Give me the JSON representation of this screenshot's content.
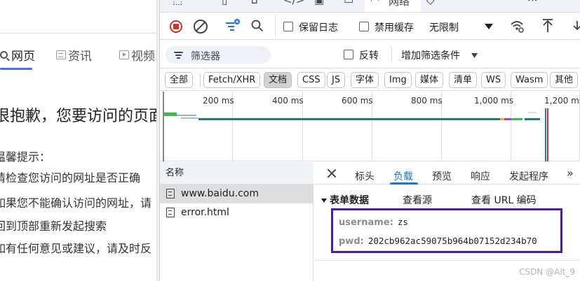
{
  "baidu": {
    "nav": [
      {
        "label": "网页",
        "icon": "search-icon",
        "active": true
      },
      {
        "label": "资讯",
        "icon": "news-icon",
        "active": false
      },
      {
        "label": "视频",
        "icon": "video-icon",
        "active": false
      }
    ],
    "headline": "很抱歉，您要访问的页面",
    "lines": [
      "温馨提示：",
      "请检查您访问的网址是否正确",
      "如果您不能确认访问的网址，请",
      "回到顶部重新发起搜索",
      "如有任何意见或建议，请及时反"
    ]
  },
  "devtools": {
    "top_tabs": [
      "网络"
    ],
    "toolbar": {
      "preserve_log": "保留日志",
      "disable_cache": "禁用缓存",
      "throttle": "无限制"
    },
    "filter": {
      "placeholder": "筛选器",
      "invert": "反转",
      "more_filters": "增加筛选条件"
    },
    "type_chips": [
      "全部",
      "Fetch/XHR",
      "文档",
      "CSS",
      "JS",
      "字体",
      "Img",
      "媒体",
      "清单",
      "WS",
      "Wasm",
      "其他"
    ],
    "selected_chip": "文档",
    "timeline_ticks": [
      "200 ms",
      "400 ms",
      "600 ms",
      "800 ms",
      "1,000 ms",
      "1,200 ms"
    ],
    "request_list": {
      "header": "名称",
      "rows": [
        {
          "name": "www.baidu.com",
          "selected": true
        },
        {
          "name": "error.html",
          "selected": false
        }
      ]
    },
    "detail": {
      "tabs": [
        "标头",
        "负载",
        "预览",
        "响应",
        "发起程序"
      ],
      "active_tab": "负载",
      "section_title": "表单数据",
      "view_source": "查看源",
      "view_url_encoded": "查看 URL 编码",
      "form": [
        {
          "key": "username:",
          "value": "zs"
        },
        {
          "key": "pwd:",
          "value": "202cb962ac59075b964b07152d234b70"
        }
      ]
    },
    "watermark": "CSDN @Alt_9"
  },
  "colors": {
    "accent": "#1a73e8",
    "record": "#d93025",
    "highlight_box": "#4a1ab5",
    "baidu_blue": "#4e6ef2"
  }
}
